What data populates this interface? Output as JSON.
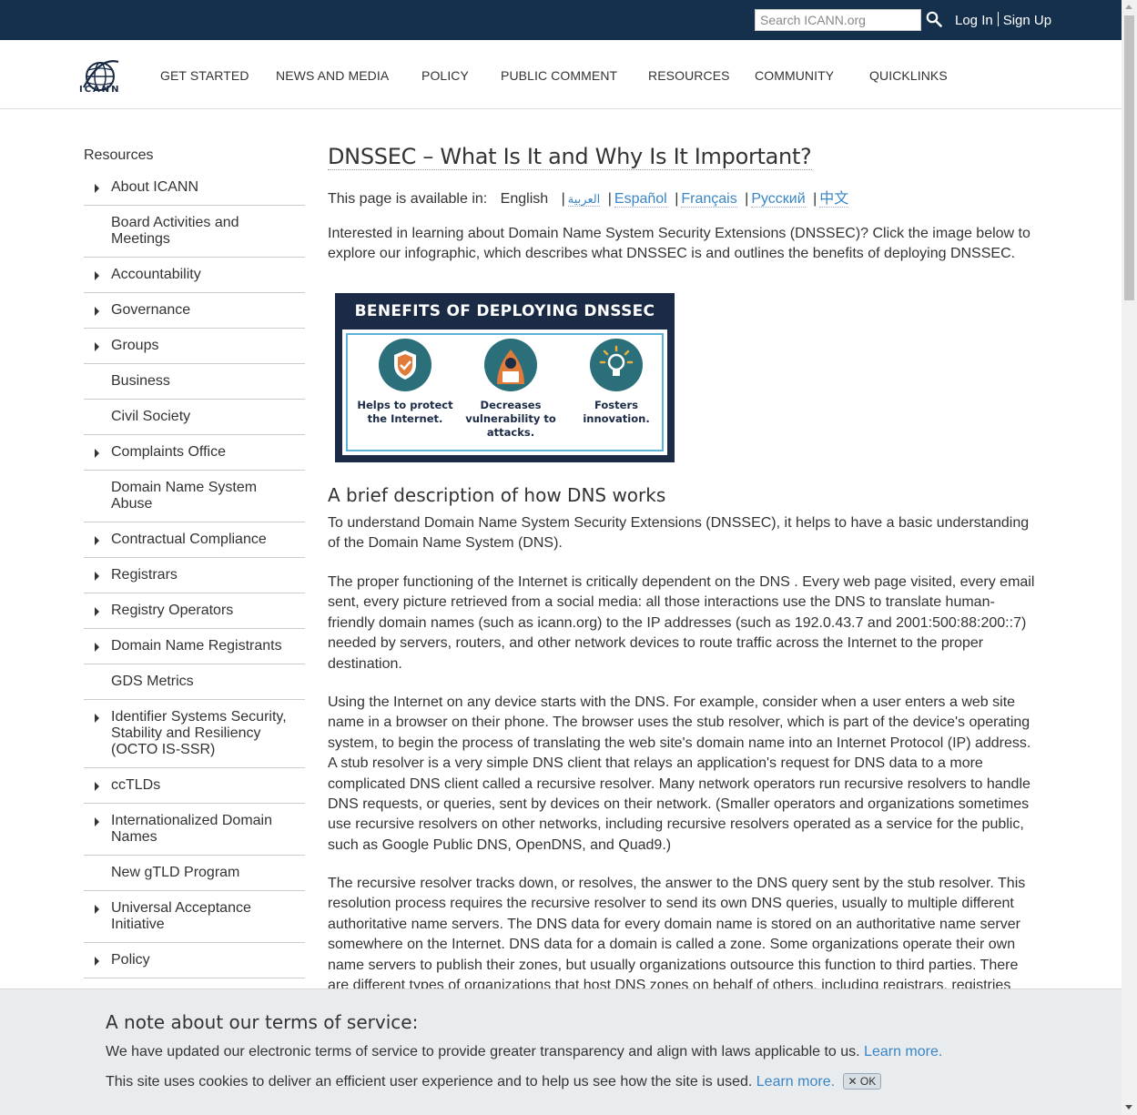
{
  "search": {
    "placeholder": "Search ICANN.org"
  },
  "auth": {
    "login": "Log In",
    "signup": "Sign Up"
  },
  "logo": {
    "text": "ICANN"
  },
  "nav": [
    "GET STARTED",
    "NEWS AND MEDIA",
    "POLICY",
    "PUBLIC COMMENT",
    "RESOURCES",
    "COMMUNITY",
    "QUICKLINKS"
  ],
  "sidebar": {
    "title": "Resources",
    "items": [
      {
        "label": "About ICANN",
        "caret": true
      },
      {
        "label": "Board Activities and Meetings",
        "caret": false
      },
      {
        "label": "Accountability",
        "caret": true
      },
      {
        "label": "Governance",
        "caret": true
      },
      {
        "label": "Groups",
        "caret": true
      },
      {
        "label": "Business",
        "caret": false
      },
      {
        "label": "Civil Society",
        "caret": false
      },
      {
        "label": "Complaints Office",
        "caret": true
      },
      {
        "label": "Domain Name System Abuse",
        "caret": false
      },
      {
        "label": "Contractual Compliance",
        "caret": true
      },
      {
        "label": "Registrars",
        "caret": true
      },
      {
        "label": "Registry Operators",
        "caret": true
      },
      {
        "label": "Domain Name Registrants",
        "caret": true
      },
      {
        "label": "GDS Metrics",
        "caret": false
      },
      {
        "label": "Identifier Systems Security, Stability and Resiliency (OCTO IS-SSR)",
        "caret": true
      },
      {
        "label": "ccTLDs",
        "caret": true
      },
      {
        "label": "Internationalized Domain Names",
        "caret": true
      },
      {
        "label": "New gTLD Program",
        "caret": false
      },
      {
        "label": "Universal Acceptance Initiative",
        "caret": true
      },
      {
        "label": "Policy",
        "caret": true
      }
    ]
  },
  "main": {
    "title": "DNSSEC – What Is It and Why Is It Important?",
    "available_label": "This page is available in:",
    "current_lang": "English",
    "langs": [
      "العربية",
      "Español",
      "Français",
      "Русский",
      "中文"
    ],
    "intro": "Interested in learning about Domain Name System Security Extensions (DNSSEC)? Click the image below to explore our infographic, which describes what DNSSEC is and outlines the benefits of deploying DNSSEC.",
    "infographic": {
      "title": "BENEFITS OF DEPLOYING DNSSEC",
      "items": [
        "Helps to protect the Internet.",
        "Decreases vulnerability to attacks.",
        "Fosters innovation."
      ]
    },
    "section_title": "A brief description of how DNS works",
    "p1": "To understand Domain Name System Security Extensions (DNSSEC), it helps to have a basic understanding of the Domain Name System (DNS).",
    "p2": "The proper functioning of the Internet is critically dependent on the DNS . Every web page visited, every email sent, every picture retrieved from a social media: all those interactions use the DNS to translate human-friendly domain names (such as icann.org) to the IP addresses (such as 192.0.43.7 and 2001:500:88:200::7) needed by servers, routers, and other network devices to route traffic across the Internet to the proper destination.",
    "p3": "Using the Internet on any device starts with the DNS. For example, consider when a user enters a web site name in a browser on their phone. The browser uses the stub resolver, which is part of the device's operating system, to begin the process of translating the web site's domain name into an Internet Protocol (IP) address. A stub resolver is a very simple DNS client that relays an application's request for DNS data to a more complicated DNS client called a recursive resolver. Many network operators run recursive resolvers to handle DNS requests, or queries, sent by devices on their network. (Smaller operators and organizations sometimes use recursive resolvers on other networks, including recursive resolvers operated as a service for the public, such as Google Public DNS, OpenDNS, and Quad9.)",
    "p4": "The recursive resolver tracks down, or resolves, the answer to the DNS query sent by the stub resolver. This resolution process requires the recursive resolver to send its own DNS queries, usually to multiple different authoritative name servers. The DNS data for every domain name is stored on an authoritative name server somewhere on the Internet. DNS data for a domain is called a zone. Some organizations operate their own name servers to publish their zones, but usually organizations outsource this function to third parties. There are different types of organizations that host DNS zones on behalf of others, including registrars, registries"
  },
  "cookie": {
    "title": "A note about our terms of service:",
    "line1": "We have updated our electronic terms of service to provide greater transparency and align with laws applicable to us.",
    "line2": "This site uses cookies to deliver an efficient user experience and to help us see how the site is used.",
    "learn_more": "Learn more.",
    "ok": "✕ OK"
  }
}
